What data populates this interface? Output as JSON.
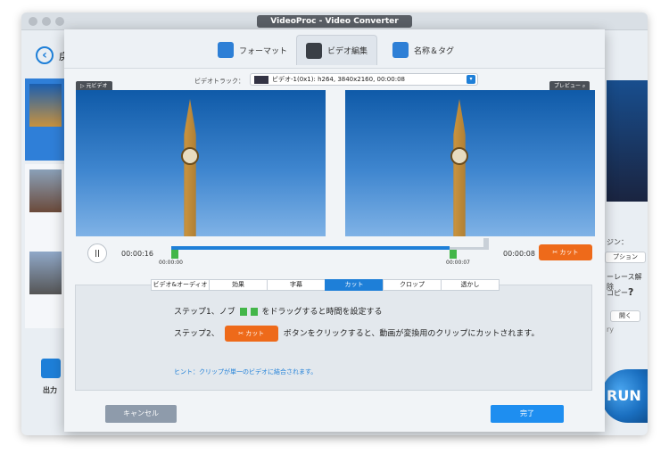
{
  "window": {
    "title": "VideoProc - Video Converter"
  },
  "main": {
    "back_label": "戻",
    "output_label": "出力",
    "run_label": "RUN",
    "right_panel": {
      "label_a": "ジン：",
      "option_btn": "プション",
      "label_b": "ーレース解除",
      "label_c": "コピー",
      "help": "?",
      "open_btn": "開く",
      "label_d": "ry"
    }
  },
  "dialog": {
    "tabs": [
      {
        "label": "フォーマット"
      },
      {
        "label": "ビデオ編集"
      },
      {
        "label": "名称＆タグ"
      }
    ],
    "track_label": "ビデオトラック：",
    "track_value": "ビデオ-1(0x1): h264, 3840x2160, 00:00:08",
    "source_label": "元ビデオ",
    "preview_label": "プレビュー",
    "timeline": {
      "play_symbol": "||",
      "current_time": "00:00:16",
      "start_marker": "00:00:00",
      "end_marker": "00:00:07",
      "end_time": "00:00:08",
      "selection_start_fraction": 0.0,
      "selection_end_fraction": 0.88
    },
    "cut_button": "カット",
    "subtabs": [
      "ビデオ&オーディオ",
      "効果",
      "字幕",
      "カット",
      "クロップ",
      "透かし"
    ],
    "active_subtab": "カット",
    "steps": {
      "step1_prefix": "ステップ1、ノブ",
      "step1_suffix": "をドラッグすると時間を設定する",
      "step2_prefix": "ステップ2、",
      "step2_suffix": "ボタンをクリックすると、動画が変換用のクリップにカットされます。"
    },
    "hint": "ヒント：クリップが単一のビデオに結合されます。",
    "cancel_label": "キャンセル",
    "done_label": "完了"
  },
  "colors": {
    "accent": "#1e7fd8",
    "cut_orange": "#ee6a1a",
    "knob_green": "#43b649"
  }
}
